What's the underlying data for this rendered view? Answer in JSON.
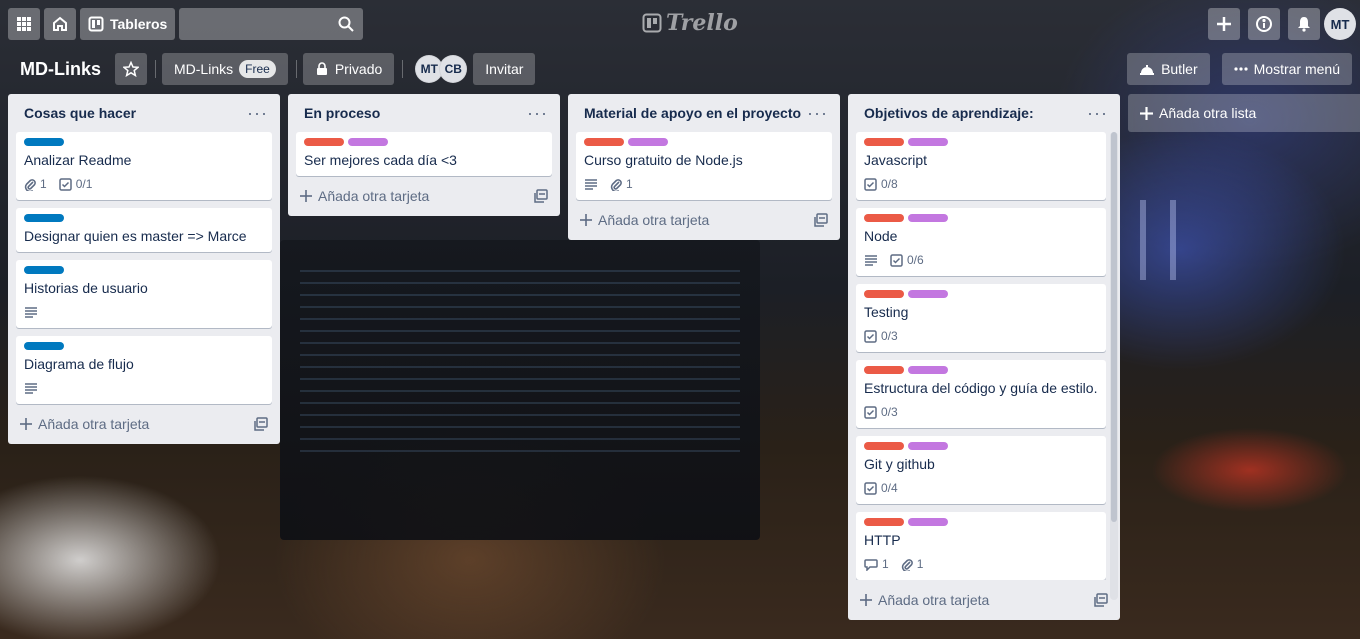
{
  "header": {
    "boards_label": "Tableros",
    "logo_text": "Trello",
    "search_placeholder": "",
    "user_initials": "MT"
  },
  "board": {
    "title": "MD-Links",
    "workspace_label": "MD-Links",
    "plan_badge": "Free",
    "visibility_label": "Privado",
    "members": [
      "MT",
      "CB"
    ],
    "invite_label": "Invitar",
    "butler_label": "Butler",
    "menu_label": "Mostrar menú",
    "add_list_label": "Añada otra lista"
  },
  "colors": {
    "label_blue": "#0079bf",
    "label_red": "#eb5a46",
    "label_purple": "#c377e0",
    "list_bg": "#ebecf0"
  },
  "lists": [
    {
      "title": "Cosas que hacer",
      "add_card_label": "Añada otra tarjeta",
      "cards": [
        {
          "title": "Analizar Readme",
          "labels": [
            "blue"
          ],
          "attachments": "1",
          "checklist": "0/1"
        },
        {
          "title": "Designar quien es master => Marce",
          "labels": [
            "blue"
          ]
        },
        {
          "title": "Historias de usuario",
          "labels": [
            "blue"
          ],
          "description": true
        },
        {
          "title": "Diagrama de flujo",
          "labels": [
            "blue"
          ],
          "description": true
        }
      ]
    },
    {
      "title": "En proceso",
      "add_card_label": "Añada otra tarjeta",
      "cards": [
        {
          "title": "Ser mejores cada día <3",
          "labels": [
            "red",
            "purple"
          ]
        }
      ]
    },
    {
      "title": "Material de apoyo en el proyecto",
      "add_card_label": "Añada otra tarjeta",
      "cards": [
        {
          "title": "Curso gratuito de Node.js",
          "labels": [
            "red",
            "purple"
          ],
          "description": true,
          "attachments": "1"
        }
      ]
    },
    {
      "title": "Objetivos de aprendizaje:",
      "add_card_label": "Añada otra tarjeta",
      "cards": [
        {
          "title": "Javascript",
          "labels": [
            "red",
            "purple"
          ],
          "checklist": "0/8"
        },
        {
          "title": "Node",
          "labels": [
            "red",
            "purple"
          ],
          "description": true,
          "checklist": "0/6"
        },
        {
          "title": "Testing",
          "labels": [
            "red",
            "purple"
          ],
          "checklist": "0/3"
        },
        {
          "title": "Estructura del código y guía de estilo.",
          "labels": [
            "red",
            "purple"
          ],
          "checklist": "0/3"
        },
        {
          "title": "Git y github",
          "labels": [
            "red",
            "purple"
          ],
          "checklist": "0/4"
        },
        {
          "title": "HTTP",
          "labels": [
            "red",
            "purple"
          ],
          "comments": "1",
          "attachments": "1"
        }
      ]
    }
  ]
}
